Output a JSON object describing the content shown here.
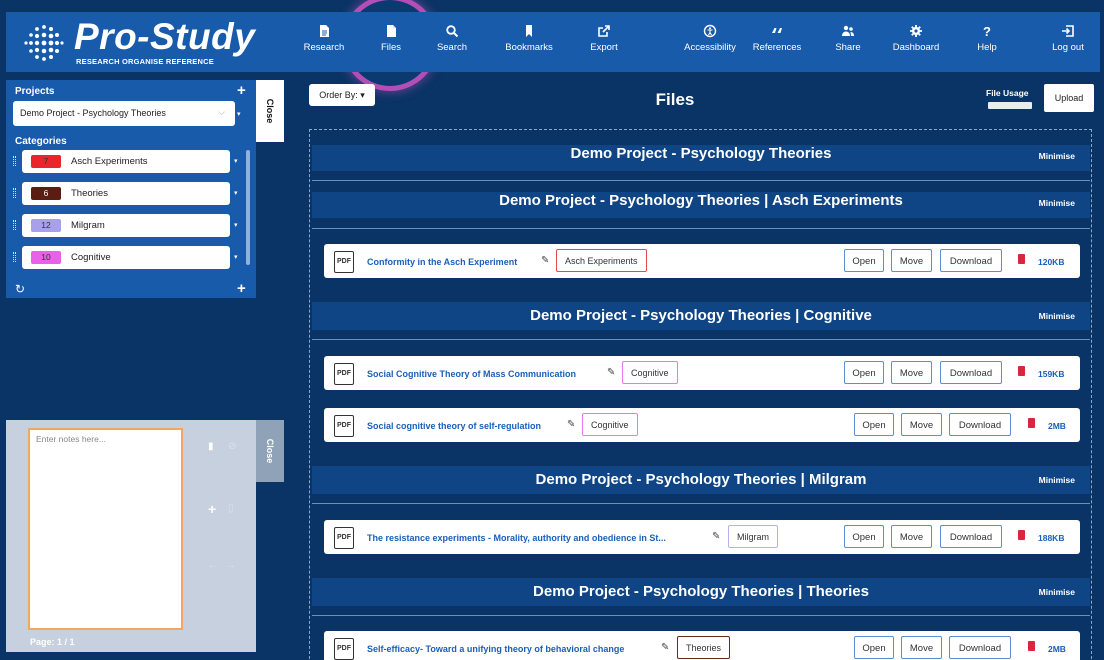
{
  "brand": {
    "title": "Pro-Study",
    "subtitle": "RESEARCH ORGANISE REFERENCE"
  },
  "nav": [
    {
      "label": "Research",
      "icon": "research-icon"
    },
    {
      "label": "Files",
      "icon": "file-icon",
      "active": true
    },
    {
      "label": "Search",
      "icon": "search-icon"
    },
    {
      "label": "Bookmarks",
      "icon": "bookmark-icon"
    },
    {
      "label": "Export",
      "icon": "export-icon"
    },
    {
      "label": "Accessibility",
      "icon": "accessibility-icon"
    },
    {
      "label": "References",
      "icon": "quote-icon"
    },
    {
      "label": "Share",
      "icon": "users-icon"
    },
    {
      "label": "Dashboard",
      "icon": "gear-icon"
    },
    {
      "label": "Help",
      "icon": "question-icon"
    },
    {
      "label": "Log out",
      "icon": "logout-icon"
    }
  ],
  "sidebar": {
    "projects_label": "Projects",
    "selected_project": "Demo Project - Psychology Theories",
    "categories_label": "Categories",
    "categories": [
      {
        "count": "7",
        "name": "Asch Experiments",
        "color": "#e8262c"
      },
      {
        "count": "6",
        "name": "Theories",
        "color": "#5a1d12"
      },
      {
        "count": "12",
        "name": "Milgram",
        "color": "#a8a0ec"
      },
      {
        "count": "10",
        "name": "Cognitive",
        "color": "#e861e8"
      }
    ],
    "close_label": "Close"
  },
  "notes": {
    "placeholder": "Enter notes here...",
    "page": "Page: 1 / 1",
    "close_label": "Close"
  },
  "main": {
    "order_by": "Order By:",
    "title": "Files",
    "file_usage": "File Usage",
    "upload": "Upload",
    "project_heading": "Demo Project - Psychology Theories",
    "minimise": "Minimise",
    "open": "Open",
    "move": "Move",
    "download": "Download",
    "sections": [
      {
        "heading": "Demo Project - Psychology Theories | Asch Experiments",
        "files": [
          {
            "name": "Conformity in the Asch Experiment",
            "tag": "Asch Experiments",
            "tag_color": "#e34a4f",
            "size": "120KB"
          }
        ]
      },
      {
        "heading": "Demo Project - Psychology Theories | Cognitive",
        "files": [
          {
            "name": "Social Cognitive Theory of Mass Communication",
            "tag": "Cognitive",
            "tag_color": "#ea78ea",
            "size": "159KB"
          },
          {
            "name": "Social cognitive theory of self-regulation",
            "tag": "Cognitive",
            "tag_color": "#ea78ea",
            "size": "2MB"
          }
        ]
      },
      {
        "heading": "Demo Project - Psychology Theories | Milgram",
        "files": [
          {
            "name": "The resistance experiments - Morality, authority and obedience in St...",
            "tag": "Milgram",
            "tag_color": "#b6b0ee",
            "size": "188KB"
          }
        ]
      },
      {
        "heading": "Demo Project - Psychology Theories | Theories",
        "files": [
          {
            "name": "Self-efficacy- Toward a unifying theory of behavioral change",
            "tag": "Theories",
            "tag_color": "#6a2a1e",
            "size": "2MB"
          }
        ]
      }
    ]
  }
}
